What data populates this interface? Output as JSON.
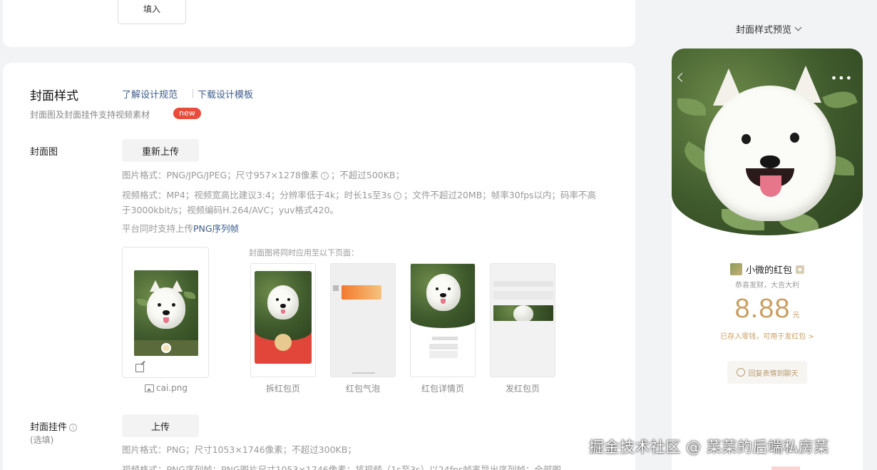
{
  "top_card": {
    "fill_button_label": "填入"
  },
  "cover_section": {
    "title": "封面样式",
    "link_guide": "了解设计规范",
    "link_template": "下载设计模板",
    "subtitle": "封面图及封面挂件支持视频素材",
    "badge": "new"
  },
  "cover_image": {
    "label": "封面图",
    "reupload_button": "重新上传",
    "spec_image_a": "图片格式：PNG/JPG/JPEG；尺寸957×1278像素",
    "spec_image_b": "；不超过500KB；",
    "spec_video_a": "视频格式：MP4；视频宽高比建议3:4；分辨率低于4k；时长1s至3s",
    "spec_video_b": "；文件不超过20MB；帧率30fps以内；码率不高于3000kbit/s；视频编码H.264/AVC；yuv格式420。",
    "png_seq_prefix": "平台同时支持上传",
    "png_seq_link": "PNG序列帧",
    "file_name": "cai.png",
    "apply_title": "封面图将同时应用至以下页面：",
    "previews": [
      "拆红包页",
      "红包气泡",
      "红包详情页",
      "发红包页"
    ]
  },
  "pendant": {
    "label": "封面挂件",
    "optional": "(选填)",
    "upload_button": "上传",
    "spec_image": "图片格式：PNG；尺寸1053×1746像素；不超过300KB；",
    "spec_video": "视频格式：PNG序列帧；PNG图片尺寸1053×1746像素；将视频（1s至3s）以24fps帧率导出序列帧；全部图"
  },
  "right_panel": {
    "title": "封面样式预览",
    "more": "•••",
    "sender_name": "小微的红包",
    "greeting": "恭喜发财，大吉大利",
    "amount": "8.88",
    "unit": "元",
    "stored_text": "已存入零钱，可用于发红包 >",
    "reply_button": "回复表情到聊天"
  },
  "watermark": "掘金技术社区 @ 菜菜的后端私房菜",
  "colors": {
    "link": "#3d5c8a",
    "badge": "#e74c3c",
    "gold": "#c9a063",
    "red_packet": "#e2463a"
  }
}
